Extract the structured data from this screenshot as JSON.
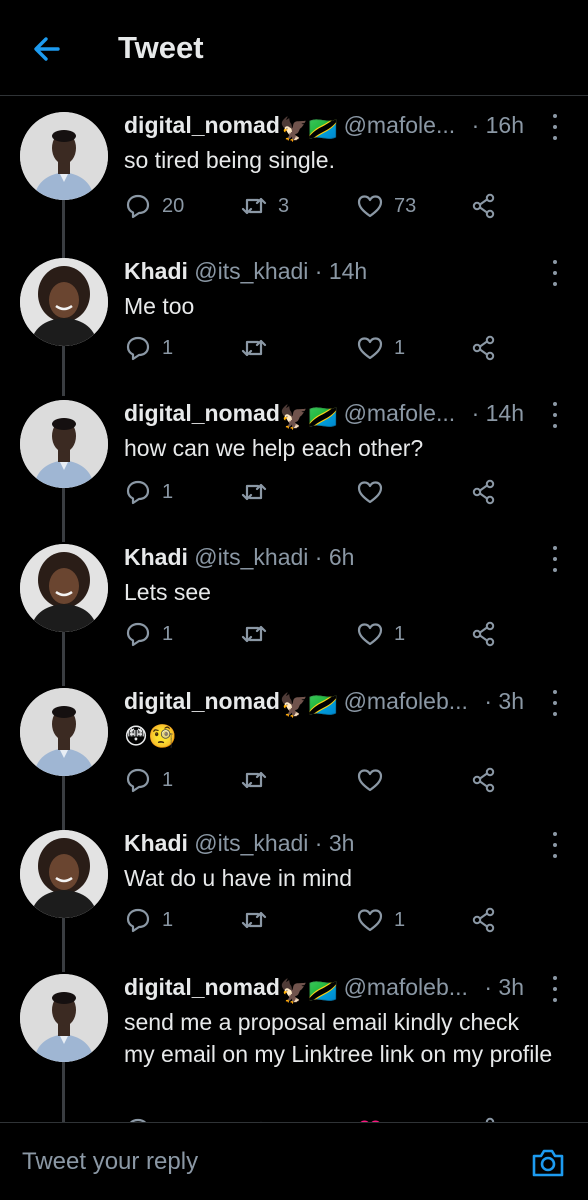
{
  "header": {
    "title": "Tweet",
    "back_icon": "arrow-left-icon",
    "accent": "#1d9bf0"
  },
  "tweets": [
    {
      "name": "digital_nomad",
      "emoji": "🦅🇹🇿",
      "handle": "@mafole...",
      "time": "· 16h",
      "text": "so tired being single.",
      "replies": "20",
      "retweets": "3",
      "likes": "73"
    },
    {
      "name": "Khadi",
      "emoji": "",
      "handle": "@its_khadi",
      "time": "· 14h",
      "text": "Me too",
      "replies": "1",
      "retweets": "",
      "likes": "1"
    },
    {
      "name": "digital_nomad",
      "emoji": "🦅🇹🇿",
      "handle": "@mafole...",
      "time": "· 14h",
      "text": "how can we help each other?",
      "replies": "1",
      "retweets": "",
      "likes": ""
    },
    {
      "name": "Khadi",
      "emoji": "",
      "handle": "@its_khadi",
      "time": "· 6h",
      "text": "Lets see",
      "replies": "1",
      "retweets": "",
      "likes": "1"
    },
    {
      "name": "digital_nomad",
      "emoji": "🦅🇹🇿",
      "handle": "@mafoleb...",
      "time": "· 3h",
      "text": "😳🧐",
      "replies": "1",
      "retweets": "",
      "likes": ""
    },
    {
      "name": "Khadi",
      "emoji": "",
      "handle": "@its_khadi",
      "time": "· 3h",
      "text": "Wat do u have in mind",
      "replies": "1",
      "retweets": "",
      "likes": "1"
    },
    {
      "name": "digital_nomad",
      "emoji": "🦅🇹🇿",
      "handle": "@mafoleb...",
      "time": "· 3h",
      "text": "send me a proposal email kindly check my email on my Linktree link on my profile",
      "replies": "",
      "retweets": "",
      "likes": ""
    }
  ],
  "reply_box": {
    "placeholder": "Tweet your reply",
    "camera_icon": "camera-icon"
  },
  "colors": {
    "background": "#000000",
    "text": "#e7e9ea",
    "secondary": "#8b98a5",
    "like_active": "#f91880"
  }
}
